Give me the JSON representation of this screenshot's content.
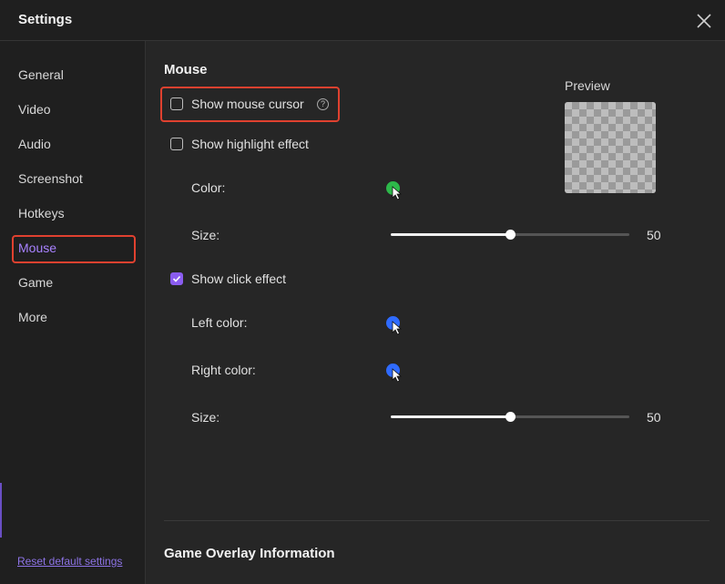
{
  "window": {
    "title": "Settings"
  },
  "sidebar": {
    "items": [
      {
        "label": "General"
      },
      {
        "label": "Video"
      },
      {
        "label": "Audio"
      },
      {
        "label": "Screenshot"
      },
      {
        "label": "Hotkeys"
      },
      {
        "label": "Mouse",
        "active": true
      },
      {
        "label": "Game"
      },
      {
        "label": "More"
      }
    ],
    "reset_label": "Reset default settings"
  },
  "mouse": {
    "section_title": "Mouse",
    "show_cursor": {
      "label": "Show mouse cursor",
      "checked": false
    },
    "show_highlight": {
      "label": "Show highlight effect",
      "checked": false
    },
    "highlight_color_label": "Color:",
    "highlight_color": "#2db84a",
    "highlight_size_label": "Size:",
    "highlight_size": 50,
    "highlight_size_text": "50",
    "show_click": {
      "label": "Show click effect",
      "checked": true
    },
    "left_color_label": "Left color:",
    "left_color": "#2f6bff",
    "right_color_label": "Right color:",
    "right_color": "#2f6bff",
    "click_size_label": "Size:",
    "click_size": 50,
    "click_size_text": "50",
    "preview_label": "Preview"
  },
  "overlay": {
    "section_title": "Game Overlay Information"
  },
  "colors": {
    "accent": "#8a5cf0",
    "highlight_outline": "#e0412f"
  }
}
